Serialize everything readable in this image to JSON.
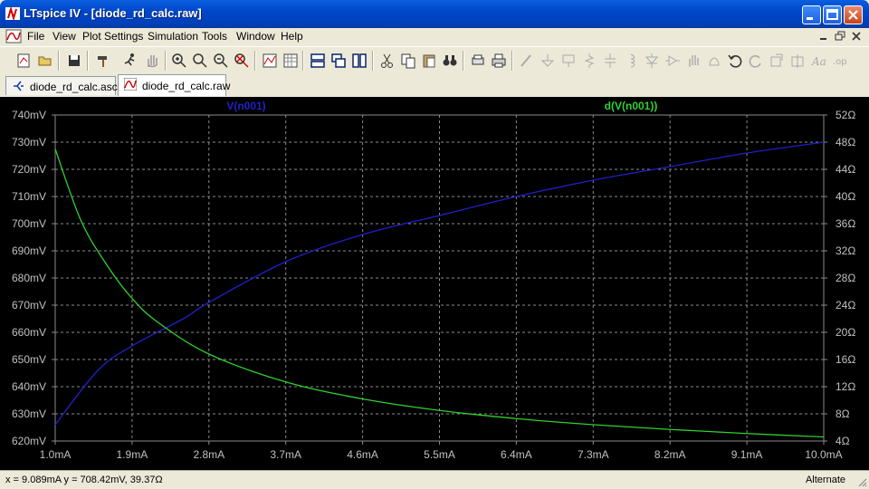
{
  "window": {
    "title": "LTspice IV - [diode_rd_calc.raw]"
  },
  "menu": [
    "File",
    "View",
    "Plot Settings",
    "Simulation",
    "Tools",
    "Window",
    "Help"
  ],
  "tabs": [
    {
      "label": "diode_rd_calc.asc",
      "active": false
    },
    {
      "label": "diode_rd_calc.raw",
      "active": true
    }
  ],
  "colors": {
    "series1": "#2020c8",
    "series2": "#30d030",
    "grid": "#8a8a8a",
    "tick_text": "#c0c0c0"
  },
  "chart_data": {
    "type": "line",
    "xlabel_ticks": [
      "1.0mA",
      "1.9mA",
      "2.8mA",
      "3.7mA",
      "4.6mA",
      "5.5mA",
      "6.4mA",
      "7.3mA",
      "8.2mA",
      "9.1mA",
      "10.0mA"
    ],
    "xlim": [
      1.0,
      10.0
    ],
    "x_unit": "mA",
    "y_left_ticks": [
      "740mV",
      "730mV",
      "720mV",
      "710mV",
      "700mV",
      "690mV",
      "680mV",
      "670mV",
      "660mV",
      "650mV",
      "640mV",
      "630mV",
      "620mV"
    ],
    "ylim_left": [
      620,
      740
    ],
    "y_right_ticks": [
      "52Ω",
      "48Ω",
      "44Ω",
      "40Ω",
      "36Ω",
      "32Ω",
      "28Ω",
      "24Ω",
      "20Ω",
      "16Ω",
      "12Ω",
      "8Ω",
      "4Ω"
    ],
    "ylim_right": [
      4,
      52
    ],
    "grid": true,
    "series": [
      {
        "name": "V(n001)",
        "axis": "left",
        "x": [
          1.0,
          1.5,
          1.9,
          2.5,
          2.8,
          3.7,
          4.6,
          5.5,
          6.4,
          7.3,
          8.2,
          9.1,
          10.0
        ],
        "y": [
          626,
          646,
          655,
          665,
          671,
          686,
          696,
          703,
          710,
          716,
          721,
          726,
          730
        ]
      },
      {
        "name": "d(V(n001))",
        "axis": "right",
        "x": [
          1.0,
          1.3,
          1.6,
          1.9,
          2.2,
          2.8,
          3.7,
          4.6,
          5.5,
          6.4,
          7.3,
          8.2,
          9.1,
          10.0
        ],
        "y": [
          47.0,
          36.5,
          30.0,
          25.0,
          21.5,
          16.8,
          12.7,
          10.2,
          8.5,
          7.3,
          6.4,
          5.7,
          5.1,
          4.6
        ]
      }
    ]
  },
  "status": {
    "coords": "x = 9.089mA    y = 708.42mV, 39.37Ω",
    "mode": "Alternate"
  }
}
